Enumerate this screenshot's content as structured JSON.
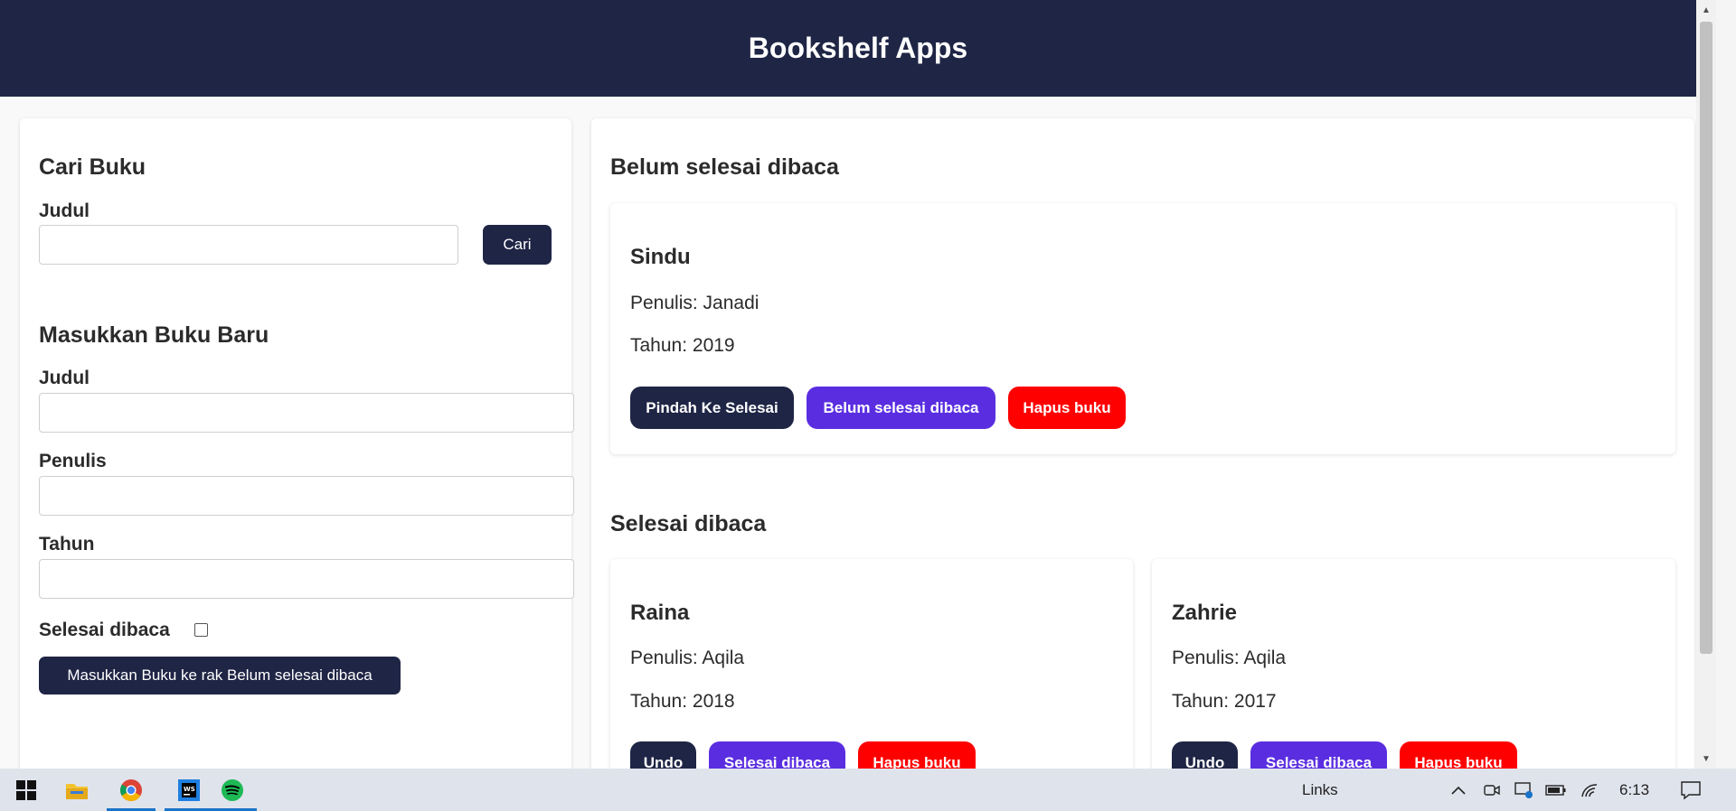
{
  "header": {
    "title": "Bookshelf Apps"
  },
  "search": {
    "heading": "Cari Buku",
    "title_label": "Judul",
    "title_value": "",
    "button_label": "Cari"
  },
  "new_book": {
    "heading": "Masukkan Buku Baru",
    "title_label": "Judul",
    "title_value": "",
    "author_label": "Penulis",
    "author_value": "",
    "year_label": "Tahun",
    "year_value": "",
    "complete_label": "Selesai dibaca",
    "complete_checked": false,
    "submit_label": "Masukkan Buku ke rak Belum selesai dibaca"
  },
  "incomplete_shelf": {
    "heading": "Belum selesai dibaca",
    "books": [
      {
        "title": "Sindu",
        "author": "Penulis: Janadi",
        "year": "Tahun: 2019",
        "btn_move": "Pindah Ke Selesai",
        "btn_status": "Belum selesai dibaca",
        "btn_delete": "Hapus buku"
      }
    ]
  },
  "complete_shelf": {
    "heading": "Selesai dibaca",
    "books": [
      {
        "title": "Raina",
        "author": "Penulis: Aqila",
        "year": "Tahun: 2018",
        "btn_move": "Undo",
        "btn_status": "Selesai dibaca",
        "btn_delete": "Hapus buku"
      },
      {
        "title": "Zahrie",
        "author": "Penulis: Aqila",
        "year": "Tahun: 2017",
        "btn_move": "Undo",
        "btn_status": "Selesai dibaca",
        "btn_delete": "Hapus buku"
      }
    ]
  },
  "colors": {
    "header_bg": "#1f2545",
    "primary_button": "#1f2545",
    "status_button": "#5a2ee0",
    "delete_button": "#ff0000"
  },
  "taskbar": {
    "apps": [
      "windows-start-icon",
      "file-explorer-icon",
      "chrome-icon",
      "webstorm-icon",
      "spotify-icon"
    ],
    "links_label": "Links",
    "clock": "6:13"
  }
}
